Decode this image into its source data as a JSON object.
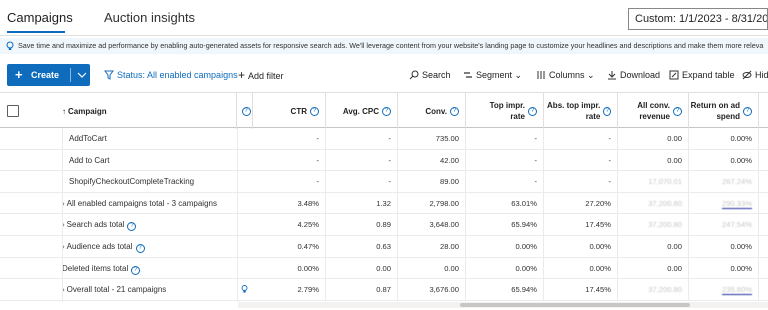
{
  "tabs": [
    {
      "label": "Campaigns",
      "active": true
    },
    {
      "label": "Auction insights",
      "active": false
    }
  ],
  "date_range": "Custom: 1/1/2023 - 8/31/2023",
  "banner": "Save time and maximize ad performance by enabling auto-generated assets for responsive search ads. We'll leverage content from your website's landing page to customize your headlines and descriptions and make them more releva",
  "toolbar": {
    "create": "Create",
    "status": "Status: All enabled campaigns",
    "add_filter": "Add filter",
    "search": "Search",
    "segment": "Segment",
    "columns": "Columns",
    "download": "Download",
    "expand": "Expand table",
    "hide": "Hid"
  },
  "columns": [
    "Campaign",
    "CTR",
    "Avg. CPC",
    "Conv.",
    "Top impr. rate",
    "Abs. top impr. rate",
    "All conv. revenue",
    "Return on ad spend"
  ],
  "rows": [
    {
      "name": "AddToCart",
      "ctr": "-",
      "cpc": "-",
      "conv": "735.00",
      "top": "-",
      "abs": "-",
      "rev": "0.00",
      "roas": "0.00%"
    },
    {
      "name": "Add to Cart",
      "ctr": "-",
      "cpc": "-",
      "conv": "42.00",
      "top": "-",
      "abs": "-",
      "rev": "0.00",
      "roas": "0.00%"
    },
    {
      "name": "ShopifyCheckoutCompleteTracking",
      "ctr": "-",
      "cpc": "-",
      "conv": "89.00",
      "top": "-",
      "abs": "-",
      "rev": "17,070.01",
      "roas": "267.24%"
    },
    {
      "name": "All enabled campaigns total - 3 campaigns",
      "ctr": "3.48%",
      "cpc": "1.32",
      "conv": "2,798.00",
      "top": "63.01%",
      "abs": "27.20%",
      "rev": "37,200.80",
      "roas": "290.33%"
    },
    {
      "name": "Search ads total",
      "ctr": "4.25%",
      "cpc": "0.89",
      "conv": "3,648.00",
      "top": "65.94%",
      "abs": "17.45%",
      "rev": "37,200.80",
      "roas": "247.54%"
    },
    {
      "name": "Audience ads total",
      "ctr": "0.47%",
      "cpc": "0.63",
      "conv": "28.00",
      "top": "0.00%",
      "abs": "0.00%",
      "rev": "0.00",
      "roas": "0.00%"
    },
    {
      "name": "Deleted items total",
      "ctr": "0.00%",
      "cpc": "0.00",
      "conv": "0.00",
      "top": "0.00%",
      "abs": "0.00%",
      "rev": "0.00",
      "roas": "0.00%"
    },
    {
      "name": "Overall total - 21 campaigns",
      "ctr": "2.79%",
      "cpc": "0.87",
      "conv": "3,676.00",
      "top": "65.94%",
      "abs": "17.45%",
      "rev": "37,200.80",
      "roas": "235.80%"
    }
  ],
  "colors": {
    "accent": "#0f6cbd",
    "underline": "#1d2a9e"
  }
}
